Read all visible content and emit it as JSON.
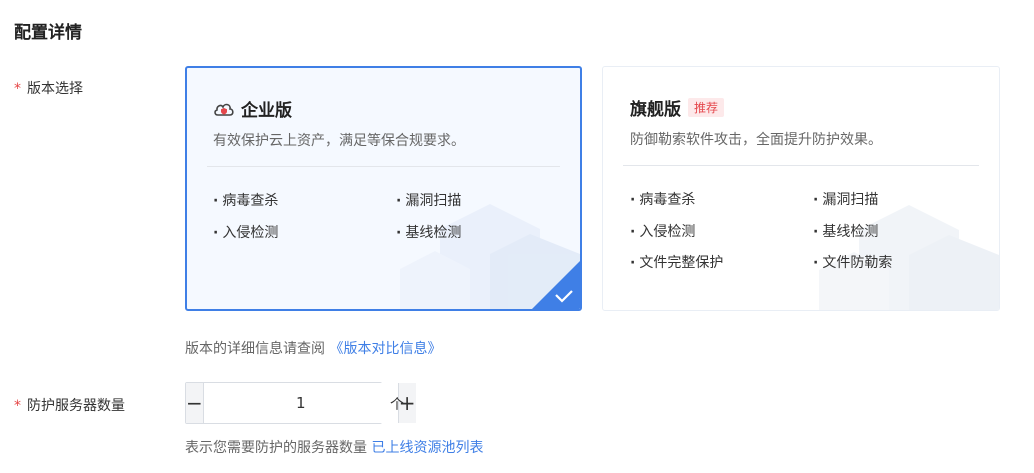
{
  "section": {
    "title": "配置详情"
  },
  "version": {
    "label": "版本选择",
    "required_mark": "*",
    "cards": [
      {
        "title": "企业版",
        "icon": "cloud-shield-icon",
        "description": "有效保护云上资产，满足等保合规要求。",
        "features": [
          "病毒查杀",
          "漏洞扫描",
          "入侵检测",
          "基线检测"
        ],
        "selected": true
      },
      {
        "title": "旗舰版",
        "badge": "推荐",
        "description": "防御勒索软件攻击，全面提升防护效果。",
        "features": [
          "病毒查杀",
          "漏洞扫描",
          "入侵检测",
          "基线检测",
          "文件完整保护",
          "文件防勒索"
        ],
        "selected": false
      }
    ],
    "hint_text": "版本的详细信息请查阅",
    "hint_link": "《版本对比信息》"
  },
  "servers": {
    "label": "防护服务器数量",
    "required_mark": "*",
    "minus": "−",
    "plus": "+",
    "value": "1",
    "unit": "个",
    "hint_text": "表示您需要防护的服务器数量",
    "hint_link": "已上线资源池列表"
  },
  "colors": {
    "accent": "#3f7fe6",
    "required": "#e54545",
    "badge": "#e5484d"
  }
}
